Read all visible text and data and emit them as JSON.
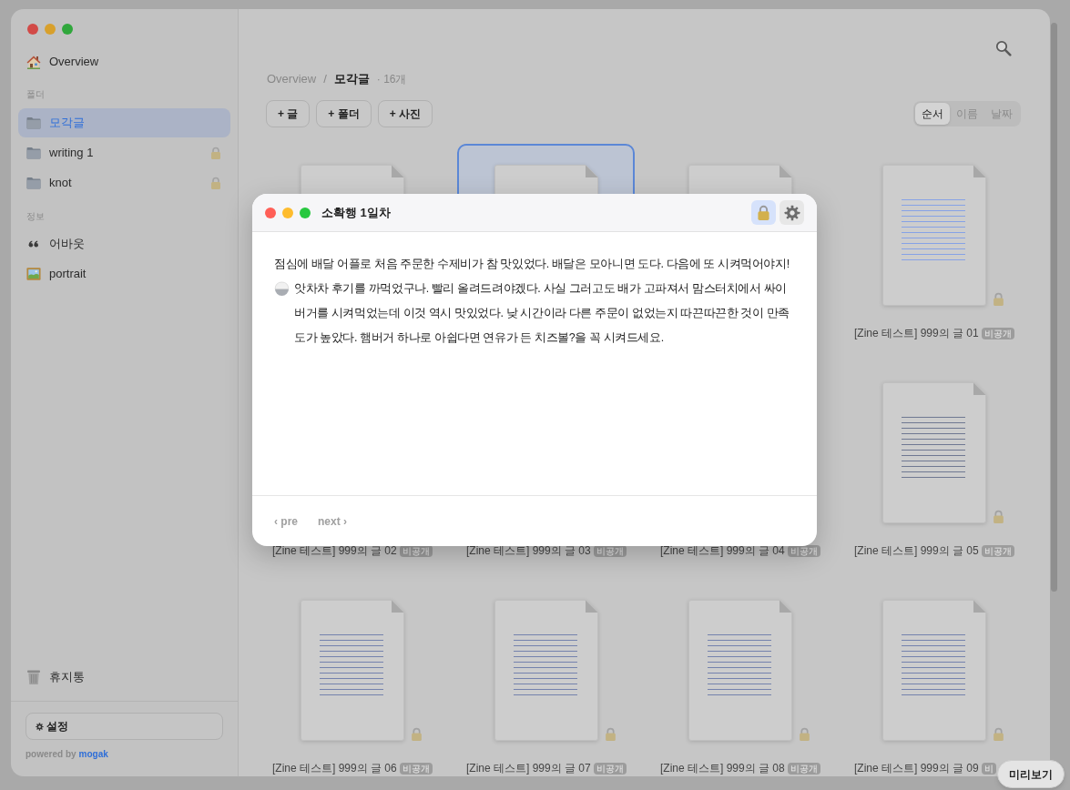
{
  "sidebar": {
    "home": {
      "kind": "home",
      "label": "Overview",
      "selected": false
    },
    "sections": [
      {
        "heading": "폴더",
        "items": [
          {
            "kind": "folder",
            "label": "모각글",
            "selected": true,
            "locked": false
          },
          {
            "kind": "folder",
            "label": "writing 1",
            "selected": false,
            "locked": true
          },
          {
            "kind": "folder",
            "label": "knot",
            "selected": false,
            "locked": true
          }
        ]
      },
      {
        "heading": "정보",
        "items": [
          {
            "kind": "quote",
            "label": "어바웃",
            "selected": false,
            "locked": false
          },
          {
            "kind": "picture",
            "label": "portrait",
            "selected": false,
            "locked": false
          }
        ]
      }
    ],
    "trash": {
      "kind": "trash",
      "label": "휴지통",
      "selected": false
    },
    "settings_button": "설정",
    "footer": {
      "text": "powered by",
      "link": "mogak"
    }
  },
  "main": {
    "breadcrumb": {
      "root": "Overview",
      "separator": "/",
      "current": "모각글",
      "count": "· 16개"
    },
    "actions": [
      "+ 글",
      "+ 폴더",
      "+ 사진"
    ],
    "sort_tabs": [
      {
        "label": "순서",
        "selected": true
      },
      {
        "label": "이름",
        "selected": false
      },
      {
        "label": "날짜",
        "selected": false
      }
    ],
    "files": [
      {
        "kind": "doc",
        "selected": false
      },
      {
        "kind": "doc",
        "selected": true
      },
      {
        "kind": "doc",
        "selected": false
      },
      {
        "kind": "doc",
        "selected": false,
        "color": "#86a2e6",
        "locked": true,
        "title": "[Zine 테스트] 999의 글 01",
        "badge": "비공개"
      },
      {
        "kind": "covered",
        "selected": false,
        "title": "[Zine 테스트] 999의 글 02",
        "badge": "비공개"
      },
      {
        "kind": "covered",
        "selected": false,
        "title": "[Zine 테스트] 999의 글 03",
        "badge": "비공개"
      },
      {
        "kind": "covered",
        "selected": false,
        "title": "[Zine 테스트] 999의 글 04",
        "badge": "비공개"
      },
      {
        "kind": "doc",
        "selected": false,
        "color": "#6f7892",
        "locked": true,
        "title": "[Zine 테스트] 999의 글 05",
        "badge": "비공개"
      },
      {
        "kind": "doc",
        "selected": false,
        "color": "#7482ad",
        "locked": true,
        "title": "[Zine 테스트] 999의 글 06",
        "badge": "비공개"
      },
      {
        "kind": "doc",
        "selected": false,
        "color": "#7482ad",
        "locked": true,
        "title": "[Zine 테스트] 999의 글 07",
        "badge": "비공개"
      },
      {
        "kind": "doc",
        "selected": false,
        "color": "#7482ad",
        "locked": true,
        "title": "[Zine 테스트] 999의 글 08",
        "badge": "비공개"
      },
      {
        "kind": "doc",
        "selected": false,
        "color": "#7482ad",
        "locked": true,
        "title": "[Zine 테스트] 999의 글 09",
        "badge": "비"
      }
    ],
    "preview_button": "미리보기"
  },
  "note": {
    "title": "소확행 1일차",
    "tools": [
      {
        "kind": "lock",
        "on": true
      },
      {
        "kind": "gear",
        "on": false
      }
    ],
    "body": [
      {
        "kind": "text",
        "text": "점심에 배달 어플로 처음 주문한 수제비가 참 맛있었다. 배달은 모아니면 도다. 다음에 또 시켜먹어야지!"
      },
      {
        "kind": "emoji"
      },
      {
        "kind": "text",
        "text": "앗차차 후기를 까먹었구나. 빨리 올려드려야겠다. 사실 그러고도 배가 고파져서 맘스터치에서 싸이버거를 시켜먹었는데 이것 역시 맛있었다. 낮 시간이라 다른 주문이 없었는지 따끈따끈한 것이 만족도가 높았다. 햄버거 하나로 아쉽다면 연유가 든 치즈볼?을 꼭 시켜드세요."
      }
    ],
    "nav": [
      "‹ pre",
      "next ›"
    ]
  }
}
